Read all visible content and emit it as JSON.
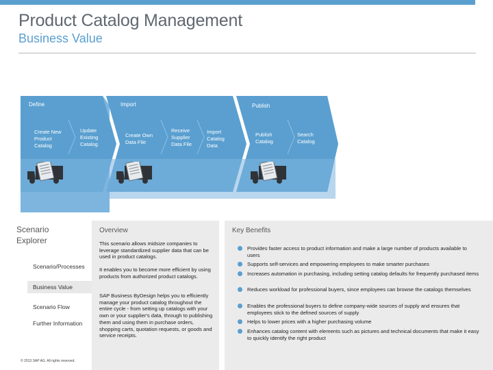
{
  "header": {
    "title": "Product Catalog Management",
    "subtitle": "Business Value"
  },
  "process": {
    "phases": [
      "Define",
      "Import",
      "Publish"
    ],
    "steps": [
      "Create New Product Catalog",
      "Update Existing Catalog",
      "Create Own Data File",
      "Receive Supplier Data File",
      "Import Catalog Data",
      "Publish Catalog",
      "Search Catalog"
    ]
  },
  "sidebar": {
    "title_line1": "Scenario",
    "title_line2": "Explorer",
    "items": [
      {
        "label": "Scenario/Processes"
      },
      {
        "label": "Business Value"
      },
      {
        "label": "Scenario Flow"
      },
      {
        "label": "Further Information"
      }
    ],
    "copyright": "© 2013 SAP AG. All rights reserved."
  },
  "overview": {
    "title": "Overview",
    "paragraphs": [
      "This scenario allows midsize companies to leverage standardized supplier data that can be used in product catalogs.",
      "It enables you to become more efficient by using products from authorized product catalogs.",
      "SAP Business ByDesign helps you to efficiently manage your product catalog throughout the entire cycle - from setting up catalogs with your own or your supplier's data, through to publishing them and using them in purchase orders, shopping carts, quotation requests, or goods and service receipts."
    ]
  },
  "benefits": {
    "title": "Key Benefits",
    "items": [
      "Provides faster access to product information and make a large number of products available to users",
      "Supports self-services and empowering employees to make smarter purchases",
      "Increases automation in purchasing, including setting catalog defaults for frequently purchased items",
      "Reduces workload for professional buyers, since employees can browse the catalogs themselves",
      "Enables the professional buyers to define company-wide sources of supply and ensures that employees stick to the defined sources of supply",
      "Helps to lower prices with a higher purchasing volume",
      "Enhances catalog content with elements such as pictures and technical documents that make it easy to quickly identify the right product"
    ]
  },
  "colors": {
    "accent": "#5a9fd0",
    "chevron_dark": "#5a9fd0",
    "chevron_light": "#7db5df"
  }
}
